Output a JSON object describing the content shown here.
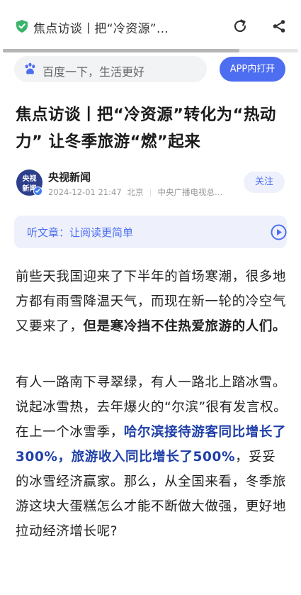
{
  "topbar": {
    "page_title": "焦点访谈丨把“冷资源”…",
    "icons": [
      "shield-check-icon",
      "refresh-icon",
      "share-icon"
    ],
    "load_progress": 0.8
  },
  "search": {
    "hint": "百度一下，生活更好",
    "app_button": "APP内打开"
  },
  "article": {
    "headline": "焦点访谈丨把“冷资源”转化为“热动力” 让冬季旅游“燃”起来",
    "author": {
      "avatar_line1": "央视",
      "avatar_line2": "新闻",
      "name": "央视新闻",
      "date": "2024-12-01 21:47",
      "location": "北京",
      "org": "中央广播电视总…",
      "follow": "关注"
    },
    "listen": {
      "label": "听文章：让阅读更简单"
    },
    "p1": {
      "t1": "前些天我国迎来了下半年的首场寒潮，很多地方都有雨雪降温天气，而现在新一轮的冷空气又要来了，",
      "b1": "但是寒冷挡不住热爱旅游的人们。"
    },
    "p2": {
      "t1": "有人一路南下寻翠绿，有人一路北上踏冰雪。说起冰雪热，去年爆火的“尔滨”很有发言权。在上一个冰雪季，",
      "b1": "哈尔滨接待游客同比增长了300%，旅游收入同比增长了500%",
      "t2": "，妥妥的冰雪经济赢家。那么，从全国来看，冬季旅游这块大蛋糕怎么才能不断做大做强，更好地拉动经济增长呢?"
    }
  },
  "colors": {
    "accent": "#4e6ef2",
    "highlight": "#1e3fa8",
    "shield": "#3bb36a"
  }
}
